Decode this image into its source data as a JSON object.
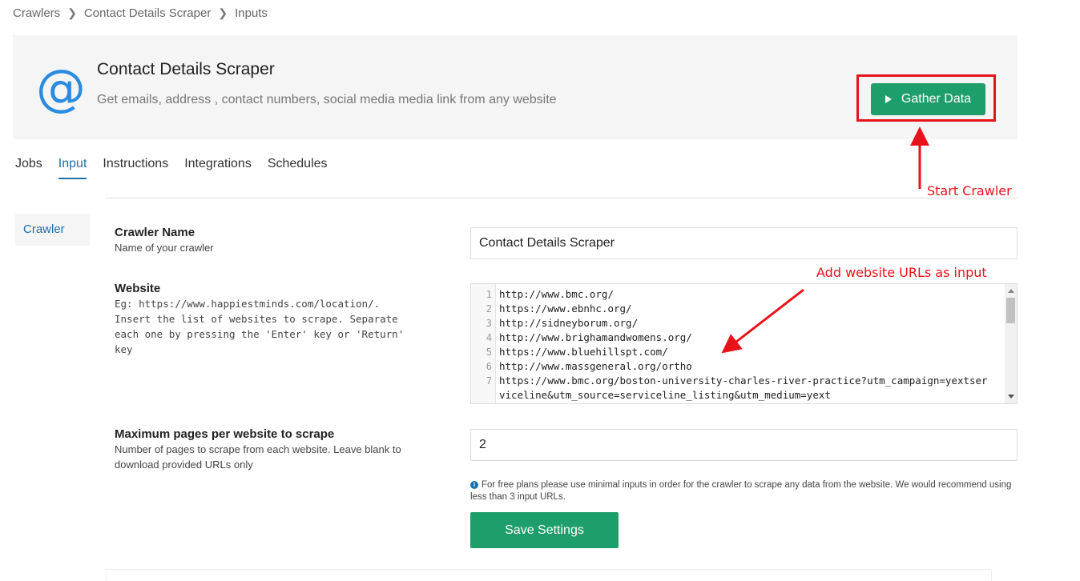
{
  "breadcrumb": {
    "items": [
      "Crawlers",
      "Contact Details Scraper",
      "Inputs"
    ]
  },
  "header": {
    "icon": "at-sign-icon",
    "title": "Contact Details Scraper",
    "subtitle": "Get emails, address , contact numbers, social media media link from any website",
    "gather_button": "Gather Data"
  },
  "tabs": [
    "Jobs",
    "Input",
    "Instructions",
    "Integrations",
    "Schedules"
  ],
  "active_tab": "Input",
  "sidebar": {
    "item": "Crawler"
  },
  "form": {
    "crawler_name": {
      "label": "Crawler Name",
      "help": "Name of your crawler",
      "value": "Contact Details Scraper"
    },
    "website": {
      "label": "Website",
      "help": "Eg: https://www.happiestminds.com/location/. Insert the list of websites to scrape. Separate each one by pressing the 'Enter' key or 'Return' key",
      "line_numbers": [
        "1",
        "2",
        "3",
        "4",
        "5",
        "6",
        "7"
      ],
      "lines": [
        "http://www.bmc.org/",
        "https://www.ebnhc.org/",
        "http://sidneyborum.org/",
        "http://www.brighamandwomens.org/",
        "https://www.bluehillspt.com/",
        "http://www.massgeneral.org/ortho",
        "https://www.bmc.org/boston-university-charles-river-practice?utm_campaign=yextser",
        "viceline&utm_source=serviceline_listing&utm_medium=yext"
      ]
    },
    "max_pages": {
      "label": "Maximum pages per website to scrape",
      "help": "Number of pages to scrape from each website. Leave blank to download provided URLs only",
      "value": "2"
    },
    "note": "For free plans please use minimal inputs in order for the crawler to scrape any data from the website. We would recommend using less than 3 input URLs.",
    "save_button": "Save Settings"
  },
  "annotations": {
    "start_crawler": "Start Crawler",
    "add_urls": "Add website URLs as input"
  },
  "colors": {
    "accent_green": "#1e9e6a",
    "link_blue": "#1c6fa8",
    "annotation_red": "#e8121b"
  }
}
